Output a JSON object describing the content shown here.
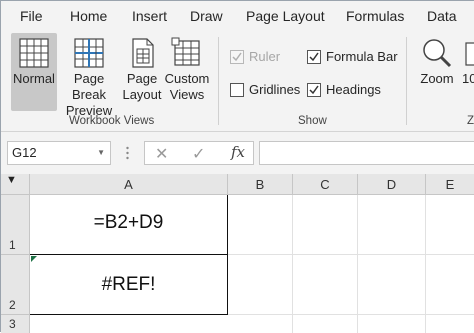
{
  "menu": {
    "tabs": [
      "File",
      "Home",
      "Insert",
      "Draw",
      "Page Layout",
      "Formulas",
      "Data"
    ]
  },
  "ribbon": {
    "workbook_views": {
      "group_label": "Workbook Views",
      "buttons": [
        {
          "line1": "Normal",
          "line2": "",
          "active": true
        },
        {
          "line1": "Page Break",
          "line2": "Preview",
          "active": false
        },
        {
          "line1": "Page",
          "line2": "Layout",
          "active": false
        },
        {
          "line1": "Custom",
          "line2": "Views",
          "active": false
        }
      ]
    },
    "show": {
      "group_label": "Show",
      "ruler": {
        "label": "Ruler",
        "checked": true,
        "disabled": true
      },
      "formula_bar": {
        "label": "Formula Bar",
        "checked": true,
        "disabled": false
      },
      "gridlines": {
        "label": "Gridlines",
        "checked": false,
        "disabled": false
      },
      "headings": {
        "label": "Headings",
        "checked": true,
        "disabled": false
      }
    },
    "zoom": {
      "label": "Zoom",
      "partial_label": "10"
    },
    "partial_group_label": "Z"
  },
  "formula_bar": {
    "name_box": "G12",
    "cancel_icon": "✕",
    "enter_icon": "✓",
    "fx_label": "fx",
    "formula": ""
  },
  "sheet": {
    "columns": [
      "A",
      "B",
      "C",
      "D",
      "E"
    ],
    "rows": [
      "1",
      "2",
      "3"
    ],
    "cells": {
      "A1": "=B2+D9",
      "A2": "#REF!"
    }
  },
  "colors": {
    "ribbon_bg": "#f3f3f3",
    "active_button": "#c8c8c8",
    "error_indicator": "#1e7145",
    "icon_blue": "#2e75b6"
  }
}
